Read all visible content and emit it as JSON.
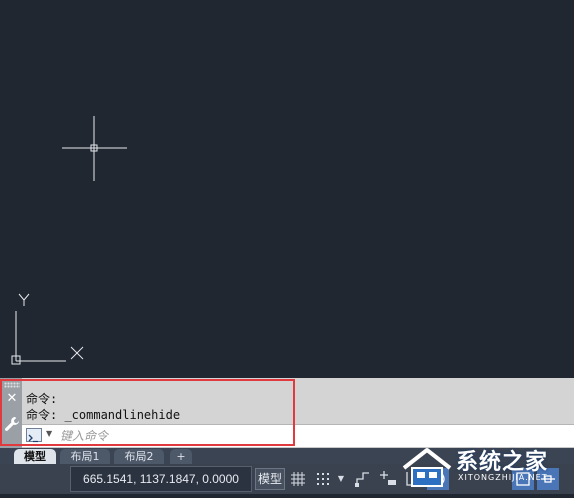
{
  "canvas": {
    "background_color": "#212730",
    "ucs": {
      "x_axis_label": "X",
      "y_axis_label": "Y"
    }
  },
  "command_line": {
    "history": [
      "命令:",
      "命令: _commandlinehide"
    ],
    "input": {
      "value": "",
      "placeholder": "键入命令"
    },
    "close_icon": "close-icon",
    "customize_icon": "wrench-icon",
    "prompt_icon": "command-prompt-icon"
  },
  "layout_tabs": {
    "tabs": [
      {
        "label": "模型",
        "active": true
      },
      {
        "label": "布局1",
        "active": false
      },
      {
        "label": "布局2",
        "active": false
      }
    ],
    "add_label": "+"
  },
  "status_bar": {
    "coordinates": "665.1541, 1137.1847, 0.0000",
    "model_label": "模型",
    "highlight_color": "#e0393e",
    "accent_color": "#4a76b8"
  },
  "watermark": {
    "title": "系统之家",
    "subtitle": "XITONGZHIJIA.NET"
  }
}
